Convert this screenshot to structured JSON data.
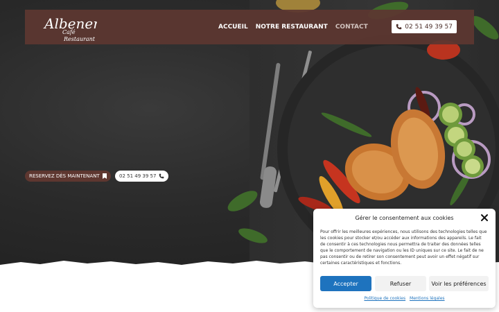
{
  "brand": {
    "logo_line1": "Albenera",
    "logo_line2": "Café",
    "logo_line3": "Restaurant"
  },
  "nav": {
    "items": [
      {
        "label": "ACCUEIL"
      },
      {
        "label": "NOTRE RESTAURANT"
      },
      {
        "label": "CONTACT"
      }
    ],
    "phone": "02 51 49 39 57"
  },
  "hero": {
    "reserve_label": "RESERVEZ DÈS MAINTENANT",
    "phone_label": "02 51 49 39 57"
  },
  "cookie": {
    "title": "Gérer le consentement aux cookies",
    "body_lines": [
      "Pour offrir les meilleures expériences, nous utilisons des technologies telles que",
      "les cookies pour stocker et/ou accéder aux informations des appareils. Le fait",
      "de consentir à ces technologies nous permettra de traiter des données telles",
      "que le comportement de navigation ou les ID uniques sur ce site. Le fait de ne",
      "pas consentir ou de retirer son consentement peut avoir un effet négatif sur",
      "certaines caractéristiques et fonctions."
    ],
    "accept": "Accepter",
    "refuse": "Refuser",
    "preferences": "Voir les préférences",
    "link_policy": "Politique de cookies",
    "link_legal": "Mentions légales"
  },
  "colors": {
    "navbar": "#5c3730",
    "accent_blue": "#1e73be"
  }
}
